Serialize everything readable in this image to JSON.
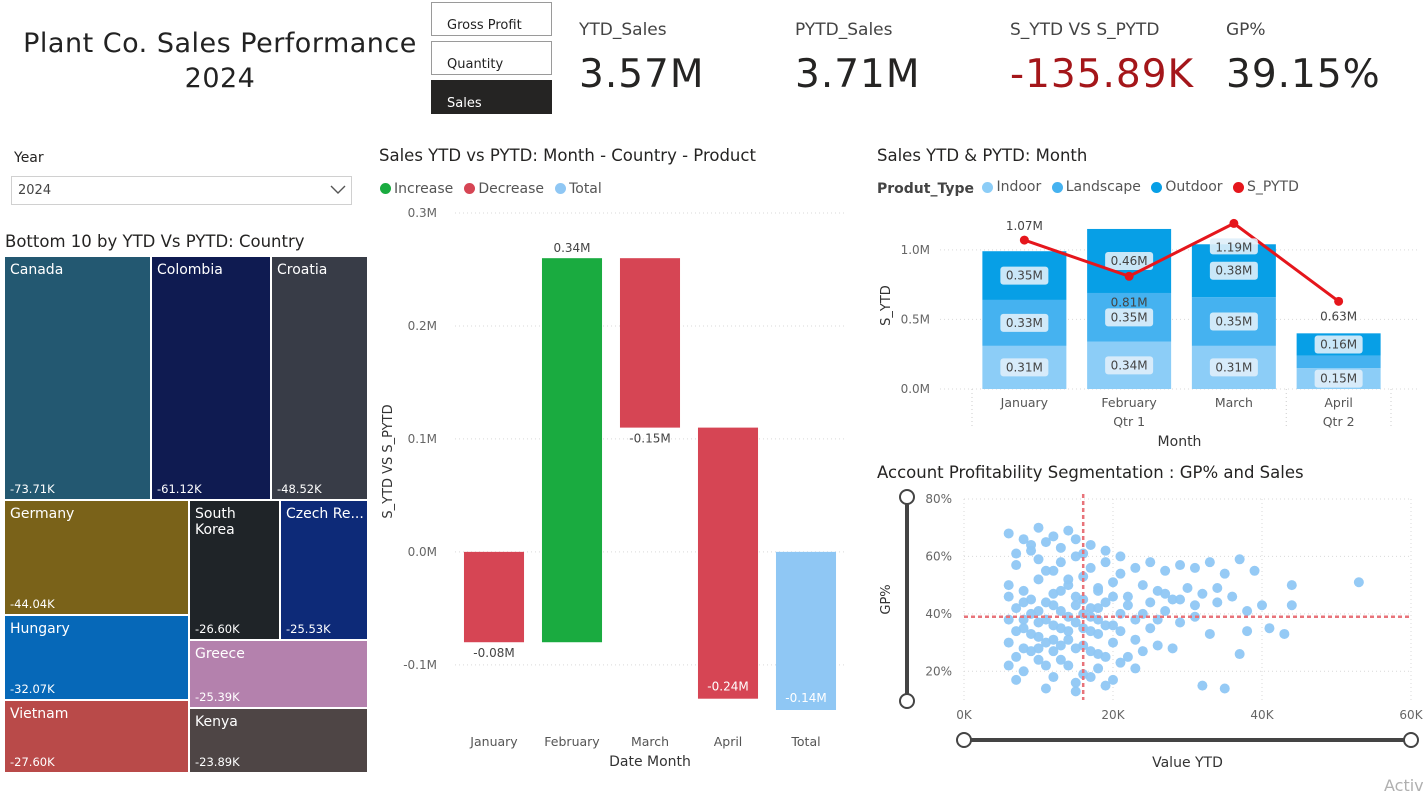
{
  "header": {
    "title_line1": "Plant Co. Sales Performance",
    "title_line2": "2024"
  },
  "measure_switch": {
    "buttons": [
      {
        "label": "Gross Profit",
        "active": false
      },
      {
        "label": "Quantity",
        "active": false
      },
      {
        "label": "Sales",
        "active": true
      }
    ]
  },
  "kpis": [
    {
      "label": "YTD_Sales",
      "value": "3.57M",
      "color": "#252423"
    },
    {
      "label": "PYTD_Sales",
      "value": "3.71M",
      "color": "#252423"
    },
    {
      "label": "S_YTD VS S_PYTD",
      "value": "-135.89K",
      "color": "#a4161a"
    },
    {
      "label": "GP%",
      "value": "39.15%",
      "color": "#252423"
    }
  ],
  "year_slicer": {
    "label": "Year",
    "value": "2024"
  },
  "treemap": {
    "title": "Bottom 10 by YTD Vs PYTD: Country",
    "tiles": [
      {
        "name": "Canada",
        "value": "-73.71K",
        "color": "#235871"
      },
      {
        "name": "Colombia",
        "value": "-61.12K",
        "color": "#0f1b51"
      },
      {
        "name": "Croatia",
        "value": "-48.52K",
        "color": "#383c47"
      },
      {
        "name": "Germany",
        "value": "-44.04K",
        "color": "#7a6219"
      },
      {
        "name": "South Korea",
        "value": "-26.60K",
        "color": "#1f2428"
      },
      {
        "name": "Czech Re...",
        "value": "-25.53K",
        "color": "#0d2a78"
      },
      {
        "name": "Hungary",
        "value": "-32.07K",
        "color": "#0668b8"
      },
      {
        "name": "Greece",
        "value": "-25.39K",
        "color": "#b481ad"
      },
      {
        "name": "Vietnam",
        "value": "-27.60K",
        "color": "#b94a49"
      },
      {
        "name": "Kenya",
        "value": "-23.89K",
        "color": "#4e4545"
      }
    ]
  },
  "waterfall": {
    "title": "Sales YTD vs PYTD: Month - Country - Product",
    "legend": [
      {
        "label": "Increase",
        "color": "#1aab40"
      },
      {
        "label": "Decrease",
        "color": "#d64554"
      },
      {
        "label": "Total",
        "color": "#8fc7f4"
      }
    ],
    "xlabel": "Date Month",
    "ylabel": "S_YTD VS S_PYTD"
  },
  "stacked": {
    "title": "Sales YTD & PYTD: Month",
    "legend_title": "Produt_Type",
    "legend": [
      {
        "label": "Indoor",
        "color": "#8ccdf7"
      },
      {
        "label": "Landscape",
        "color": "#45b2f0"
      },
      {
        "label": "Outdoor",
        "color": "#079fe6"
      },
      {
        "label": "S_PYTD",
        "color": "#e5161c"
      }
    ],
    "xlabel": "Month",
    "ylabel": "S_YTD",
    "quarters": [
      "Qtr 1",
      "Qtr 2"
    ]
  },
  "scatter": {
    "title": "Account Profitability Segmentation : GP% and Sales",
    "xlabel": "Value YTD",
    "ylabel": "GP%"
  },
  "footer": {
    "watermark": "Activ"
  },
  "chart_data": [
    {
      "type": "bar",
      "subtype": "waterfall",
      "title": "Sales YTD vs PYTD: Month - Country - Product",
      "categories": [
        "January",
        "February",
        "March",
        "April",
        "Total"
      ],
      "values": [
        -0.08,
        0.34,
        -0.15,
        -0.24,
        -0.14
      ],
      "data_labels": [
        "-0.08M",
        "0.34M",
        "-0.15M",
        "-0.24M",
        "-0.14M"
      ],
      "xlabel": "Date Month",
      "ylabel": "S_YTD VS S_PYTD",
      "ylim": [
        -0.14,
        0.3
      ],
      "y_ticks": [
        -0.1,
        0.0,
        0.1,
        0.2,
        0.3
      ],
      "y_tick_labels": [
        "-0.1M",
        "0.0M",
        "0.1M",
        "0.2M",
        "0.3M"
      ],
      "grid": true,
      "legend": "top-left"
    },
    {
      "type": "bar",
      "subtype": "stacked_with_line",
      "title": "Sales YTD & PYTD: Month",
      "categories": [
        "January",
        "February",
        "March",
        "April"
      ],
      "series": [
        {
          "name": "Indoor",
          "values": [
            0.31,
            0.34,
            0.31,
            0.15
          ],
          "labels": [
            "0.31M",
            "0.34M",
            "0.31M",
            "0.15M"
          ]
        },
        {
          "name": "Landscape",
          "values": [
            0.33,
            0.35,
            0.35,
            0.09
          ],
          "labels": [
            "0.33M",
            "0.35M",
            "0.35M",
            ""
          ]
        },
        {
          "name": "Outdoor",
          "values": [
            0.35,
            0.46,
            0.38,
            0.16
          ],
          "labels": [
            "0.35M",
            "0.46M",
            "0.38M",
            "0.16M"
          ]
        },
        {
          "name": "S_PYTD",
          "type": "line",
          "values": [
            1.07,
            0.81,
            1.19,
            0.63
          ],
          "labels": [
            "1.07M",
            "0.81M",
            "1.19M",
            "0.63M"
          ]
        }
      ],
      "xlabel": "Month",
      "ylabel": "S_YTD",
      "ylim": [
        0,
        1.2
      ],
      "y_ticks": [
        0,
        0.5,
        1.0
      ],
      "y_tick_labels": [
        "0.0M",
        "0.5M",
        "1.0M"
      ],
      "quarter_labels": [
        "Qtr 1",
        "Qtr 2"
      ],
      "grid": true,
      "legend": "top-left"
    },
    {
      "type": "scatter",
      "title": "Account Profitability Segmentation : GP% and Sales",
      "xlabel": "Value YTD",
      "ylabel": "GP%",
      "xlim": [
        0,
        60000
      ],
      "ylim": [
        10,
        80
      ],
      "x_tick_labels": [
        "0K",
        "20K",
        "40K",
        "60K"
      ],
      "y_tick_labels": [
        "20%",
        "40%",
        "60%",
        "80%"
      ],
      "reference_lines": {
        "x": 16000,
        "y": 39
      },
      "points": [
        [
          6000,
          68
        ],
        [
          8000,
          66
        ],
        [
          10000,
          70
        ],
        [
          12000,
          67
        ],
        [
          14000,
          69
        ],
        [
          9000,
          62
        ],
        [
          7000,
          57
        ],
        [
          11000,
          55
        ],
        [
          13000,
          58
        ],
        [
          15000,
          60
        ],
        [
          17000,
          64
        ],
        [
          19000,
          62
        ],
        [
          21000,
          60
        ],
        [
          23000,
          56
        ],
        [
          25000,
          58
        ],
        [
          27000,
          55
        ],
        [
          29000,
          57
        ],
        [
          31000,
          56
        ],
        [
          33000,
          58
        ],
        [
          35000,
          54
        ],
        [
          37000,
          59
        ],
        [
          39000,
          55
        ],
        [
          6000,
          50
        ],
        [
          8000,
          48
        ],
        [
          10000,
          52
        ],
        [
          12000,
          47
        ],
        [
          14000,
          50
        ],
        [
          16000,
          53
        ],
        [
          18000,
          49
        ],
        [
          20000,
          51
        ],
        [
          22000,
          46
        ],
        [
          24000,
          50
        ],
        [
          26000,
          48
        ],
        [
          28000,
          45
        ],
        [
          30000,
          49
        ],
        [
          32000,
          47
        ],
        [
          34000,
          44
        ],
        [
          36000,
          46
        ],
        [
          38000,
          41
        ],
        [
          40000,
          43
        ],
        [
          44000,
          43
        ],
        [
          7000,
          42
        ],
        [
          9000,
          40
        ],
        [
          11000,
          38
        ],
        [
          13000,
          41
        ],
        [
          15000,
          37
        ],
        [
          17000,
          39
        ],
        [
          19000,
          36
        ],
        [
          21000,
          40
        ],
        [
          23000,
          38
        ],
        [
          25000,
          35
        ],
        [
          27000,
          41
        ],
        [
          29000,
          37
        ],
        [
          31000,
          39
        ],
        [
          33000,
          33
        ],
        [
          38000,
          34
        ],
        [
          41000,
          35
        ],
        [
          43000,
          33
        ],
        [
          6000,
          30
        ],
        [
          8000,
          28
        ],
        [
          10000,
          32
        ],
        [
          12000,
          27
        ],
        [
          14000,
          31
        ],
        [
          16000,
          29
        ],
        [
          18000,
          26
        ],
        [
          20000,
          30
        ],
        [
          22000,
          25
        ],
        [
          24000,
          27
        ],
        [
          26000,
          29
        ],
        [
          28000,
          28
        ],
        [
          37000,
          26
        ],
        [
          6000,
          22
        ],
        [
          8000,
          20
        ],
        [
          10000,
          24
        ],
        [
          12000,
          18
        ],
        [
          14000,
          22
        ],
        [
          16000,
          19
        ],
        [
          18000,
          21
        ],
        [
          20000,
          17
        ],
        [
          7000,
          17
        ],
        [
          11000,
          14
        ],
        [
          15000,
          13
        ],
        [
          32000,
          15
        ],
        [
          35000,
          14
        ],
        [
          44000,
          50
        ],
        [
          53000,
          51
        ],
        [
          16000,
          45
        ],
        [
          17000,
          34
        ],
        [
          18000,
          42
        ],
        [
          13000,
          35
        ],
        [
          9000,
          45
        ],
        [
          11000,
          44
        ],
        [
          15000,
          43
        ],
        [
          19000,
          44
        ],
        [
          21000,
          34
        ],
        [
          23000,
          31
        ],
        [
          12000,
          55
        ],
        [
          14000,
          52
        ],
        [
          10000,
          59
        ],
        [
          8000,
          38
        ],
        [
          6000,
          38
        ],
        [
          7000,
          34
        ],
        [
          9000,
          33
        ],
        [
          11000,
          30
        ],
        [
          13000,
          29
        ],
        [
          15000,
          28
        ],
        [
          17000,
          27
        ],
        [
          19000,
          25
        ],
        [
          21000,
          23
        ],
        [
          23000,
          21
        ],
        [
          25000,
          44
        ],
        [
          27000,
          47
        ],
        [
          29000,
          45
        ],
        [
          31000,
          43
        ],
        [
          34000,
          49
        ],
        [
          17000,
          56
        ],
        [
          19000,
          58
        ],
        [
          21000,
          54
        ],
        [
          16000,
          61
        ],
        [
          18000,
          48
        ],
        [
          20000,
          46
        ],
        [
          22000,
          43
        ],
        [
          24000,
          40
        ],
        [
          26000,
          38
        ],
        [
          15000,
          46
        ],
        [
          13000,
          48
        ],
        [
          12000,
          43
        ],
        [
          10000,
          37
        ],
        [
          8000,
          35
        ],
        [
          7000,
          25
        ],
        [
          9000,
          27
        ],
        [
          11000,
          22
        ],
        [
          13000,
          24
        ],
        [
          15000,
          16
        ],
        [
          17000,
          18
        ],
        [
          19000,
          15
        ],
        [
          16000,
          35
        ],
        [
          18000,
          38
        ],
        [
          20000,
          36
        ],
        [
          14000,
          39
        ],
        [
          12000,
          36
        ],
        [
          10000,
          41
        ],
        [
          8000,
          44
        ],
        [
          6000,
          46
        ],
        [
          11000,
          65
        ],
        [
          13000,
          63
        ],
        [
          15000,
          66
        ],
        [
          9000,
          64
        ],
        [
          7000,
          61
        ],
        [
          16000,
          40
        ],
        [
          17000,
          42
        ],
        [
          18000,
          33
        ],
        [
          14000,
          34
        ],
        [
          12000,
          31
        ],
        [
          10000,
          28
        ]
      ]
    }
  ]
}
